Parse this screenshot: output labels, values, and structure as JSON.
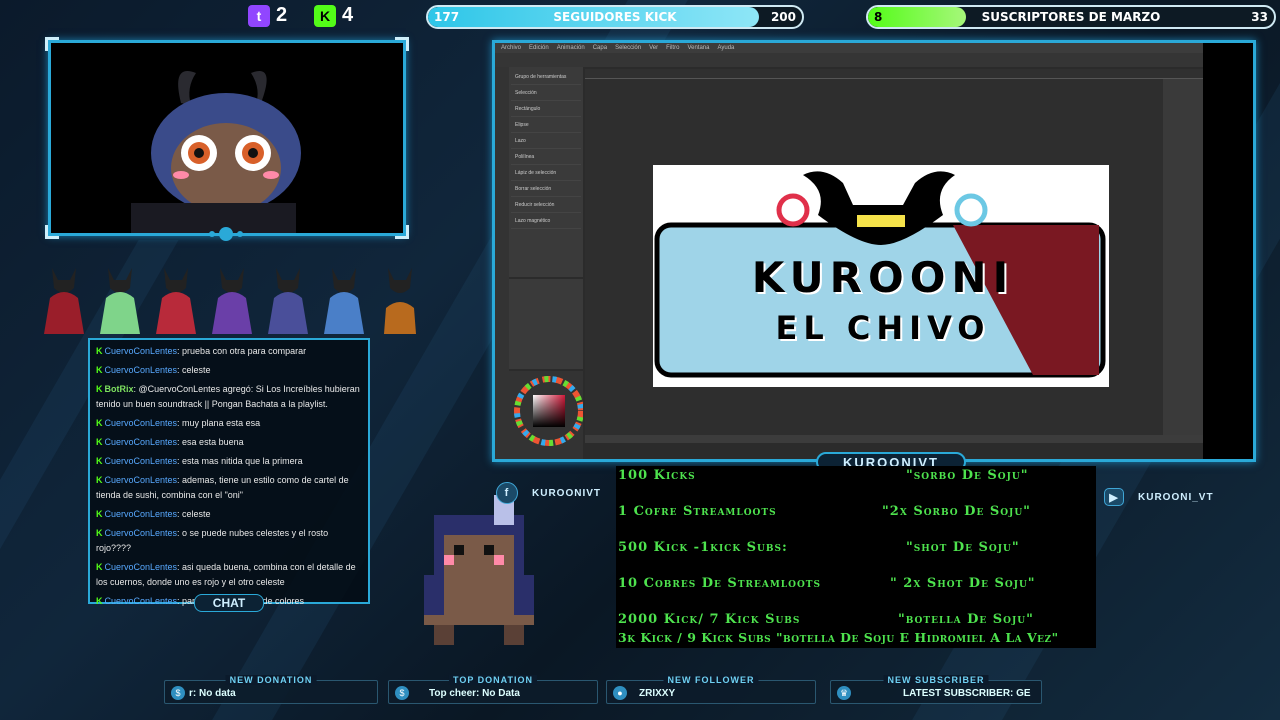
{
  "top": {
    "twitch_count": "2",
    "kick_count": "4",
    "kick_goal": {
      "label": "SEGUIDORES KICK",
      "current": "177",
      "target": "200",
      "progress": 0.885
    },
    "sub_goal": {
      "label": "SUSCRIPTORES DE MARZO",
      "current": "8",
      "target": "33",
      "progress": 0.242
    }
  },
  "chat": {
    "label": "CHAT",
    "messages": [
      {
        "user": "CuervoConLentes",
        "text": ": prueba con otra para comparar"
      },
      {
        "user": "CuervoConLentes",
        "text": ": celeste"
      },
      {
        "user": "BotRix",
        "text": ": @CuervoConLentes agregó: Si Los Increíbles hubieran tenido un buen soundtrack || Pongan Bachata a la playlist."
      },
      {
        "user": "CuervoConLentes",
        "text": ": muy plana esta esa"
      },
      {
        "user": "CuervoConLentes",
        "text": ": esa esta buena"
      },
      {
        "user": "CuervoConLentes",
        "text": ": esta mas nitida que la primera"
      },
      {
        "user": "CuervoConLentes",
        "text": ": ademas, tiene un estilo como de cartel de tienda de sushi, combina con el \"oni\""
      },
      {
        "user": "CuervoConLentes",
        "text": ": celeste"
      },
      {
        "user": "CuervoConLentes",
        "text": ": o se puede nubes celestes y el rosto rojo????"
      },
      {
        "user": "CuervoConLentes",
        "text": ": asi queda buena, combina con el detalle de los cuernos, donde uno es rojo y el otro celeste"
      },
      {
        "user": "CuervoConLentes",
        "text": ": para esa \"dualidad\" de colores"
      }
    ]
  },
  "screen": {
    "menu": [
      "Archivo",
      "Edición",
      "Animación",
      "Capa",
      "Selección",
      "Ver",
      "Filtro",
      "Ventana",
      "Ayuda"
    ],
    "tool_panel": [
      "Grupo de herramientas",
      "Selección",
      "Rectángulo",
      "Elipse",
      "Lazo",
      "Polilínea",
      "Lápiz de selección",
      "Borrar selección",
      "Reducir selección",
      "Lazo magnético"
    ],
    "canvas_title_1": "KUROONI",
    "canvas_title_2": "EL CHIVO"
  },
  "banner": "KUROONIVT",
  "goals": [
    {
      "req": "100 Kicks",
      "reward": "\"sorbo De Soju\""
    },
    {
      "req": "1 Cofre Streamloots",
      "reward": "\"2x Sorbo De Soju\""
    },
    {
      "req": "500 Kick -1kick Subs:",
      "reward": "\"shot De Soju\""
    },
    {
      "req": "10 Cobres De Streamloots",
      "reward": "\" 2x Shot De Soju\""
    },
    {
      "req": "2000 Kick/ 7 Kick Subs",
      "reward": "\"botella De Soju\""
    },
    {
      "req": "3k Kick / 9 Kick Subs \"botella De Soju E Hidromiel A La Vez\"",
      "reward": ""
    }
  ],
  "socials": {
    "facebook": "KUROONIVT",
    "youtube": "KUROONI_VT"
  },
  "alerts": {
    "donation": {
      "title": "NEW DONATION",
      "value": "r: No data"
    },
    "top_donation": {
      "title": "TOP DONATION",
      "value": "Top cheer: No Data"
    },
    "follower": {
      "title": "NEW FOLLOWER",
      "value": "ZRIXXY"
    },
    "subscriber": {
      "title": "NEW SUBSCRIBER",
      "value": "LATEST SUBSCRIBER: GE"
    }
  },
  "colors": {
    "accent": "#2aa9d8",
    "kick_green": "#53fc18",
    "twitch_purple": "#9146ff",
    "goal_text": "#4ee34e"
  }
}
